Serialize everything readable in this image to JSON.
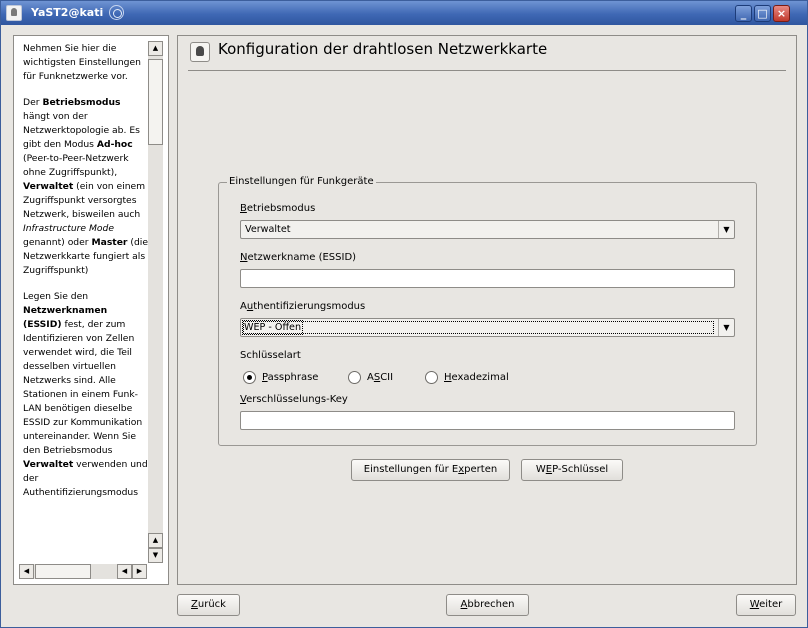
{
  "window": {
    "title": "YaST2@kati",
    "controls": {
      "minimize": "minimize-icon",
      "maximize": "maximize-icon",
      "close": "close-icon"
    }
  },
  "help": {
    "p1": "Nehmen Sie hier die wichtigsten Einstellungen für Funknetzwerke vor.",
    "p2_pre": "Der ",
    "p2_b1": "Betriebsmodus",
    "p2_mid1": " hängt von der Netzwerktopologie ab. Es gibt den Modus ",
    "p2_b2": "Ad-hoc",
    "p2_mid2": " (Peer-to-Peer-Netzwerk ohne Zugriffspunkt), ",
    "p2_b3": "Verwaltet",
    "p2_mid3": " (ein von einem Zugriffspunkt versorgtes Netzwerk, bisweilen auch ",
    "p2_i": "Infrastructure Mode",
    "p2_mid4": " genannt) oder ",
    "p2_b4": "Master",
    "p2_end": " (die Netzwerkkarte fungiert als Zugriffspunkt)",
    "p3_pre": "Legen Sie den ",
    "p3_b1": "Netzwerknamen (ESSID)",
    "p3_mid": " fest, der zum Identifizieren von Zellen verwendet wird, die Teil desselben virtuellen Netzwerks sind. Alle Stationen in einem Funk-LAN benötigen dieselbe ESSID zur Kommunikation untereinander. Wenn Sie den Betriebsmodus ",
    "p3_b2": "Verwaltet",
    "p3_end": " verwenden und der Authentifizierungsmodus"
  },
  "main": {
    "title": "Konfiguration der drahtlosen Netzwerkkarte",
    "group_title": "Einstellungen für Funkgeräte",
    "mode_label": {
      "pre": "",
      "u": "B",
      "post": "etriebsmodus"
    },
    "mode_value": "Verwaltet",
    "essid_label": {
      "pre": "",
      "u": "N",
      "post": "etzwerkname (ESSID)"
    },
    "essid_value": "",
    "auth_label": {
      "pre": "A",
      "u": "u",
      "post": "thentifizierungsmodus"
    },
    "auth_value": "WEP - Offen",
    "keytype_label": "Schlüsselart",
    "radios": [
      {
        "pre": "",
        "u": "P",
        "post": "assphrase",
        "selected": true
      },
      {
        "pre": "A",
        "u": "S",
        "post": "CII",
        "selected": false
      },
      {
        "pre": "",
        "u": "H",
        "post": "exadezimal",
        "selected": false
      }
    ],
    "key_label": {
      "pre": "",
      "u": "V",
      "post": "erschlüsselungs-Key"
    },
    "key_value": "",
    "expert_button": {
      "pre": "Einstellungen für E",
      "u": "x",
      "post": "perten"
    },
    "wep_button": {
      "pre": "W",
      "u": "E",
      "post": "P-Schlüssel"
    }
  },
  "footer": {
    "back": {
      "pre": "",
      "u": "Z",
      "post": "urück"
    },
    "abort": {
      "pre": "",
      "u": "A",
      "post": "bbrechen"
    },
    "next": {
      "pre": "",
      "u": "W",
      "post": "eiter"
    }
  }
}
